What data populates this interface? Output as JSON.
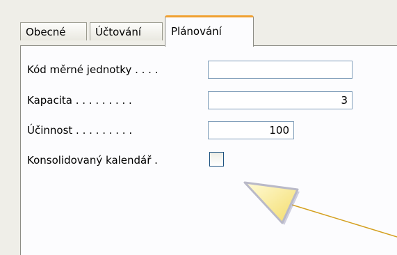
{
  "tabs": [
    {
      "label": "Obecné"
    },
    {
      "label": "Účtování"
    },
    {
      "label": "Plánování"
    }
  ],
  "fields": {
    "unit_code": {
      "label": "Kód měrné jednotky . . . .",
      "value": ""
    },
    "capacity": {
      "label": "Kapacita . . . . . . . . .",
      "value": "3"
    },
    "efficiency": {
      "label": "Účinnost . . . . . . . . .",
      "value": "100"
    },
    "consolidated": {
      "label": "Konsolidovaný kalendář .",
      "checked": false
    }
  },
  "colors": {
    "window_bg": "#efeee8",
    "panel_bg": "#fcfcfe",
    "active_tab_accent": "#f0a030",
    "field_border": "#7f9db9",
    "callout_fill": "#fff4a0",
    "leader_line": "#d4a020"
  }
}
